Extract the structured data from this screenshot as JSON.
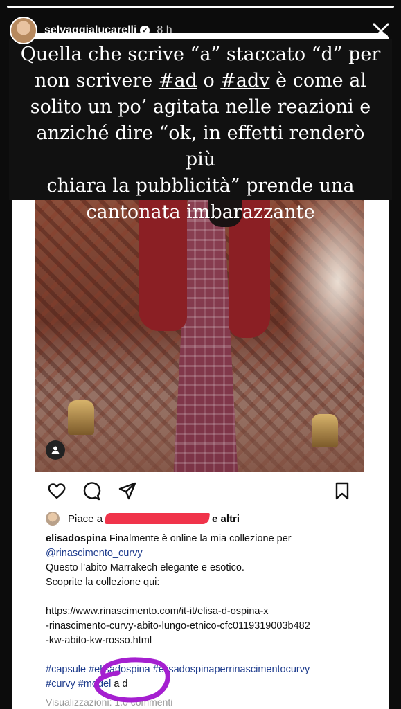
{
  "story": {
    "username": "selvaggialucarelli",
    "time": "8 h",
    "progress": 1.0,
    "caption_lines": [
      [
        "Quella che scrive “a” staccato “d” per"
      ],
      [
        "non scrivere ",
        "#ad",
        " o ",
        "#adv",
        " è come al"
      ],
      [
        "solito un po’ agitata nelle reazioni e"
      ],
      [
        "anziché dire “ok, in effetti renderò più"
      ],
      [
        "chiara la pubblicità” prende una"
      ],
      [
        "cantonata imbarazzante"
      ]
    ]
  },
  "post": {
    "likes_prefix": "Piace a",
    "likes_suffix": "e altri",
    "author": "elisadospina",
    "text_line1": "Finalmente è online la mia collezione per",
    "mention": "@rinascimento_curvy",
    "line3": "Questo l’abito Marrakech elegante e esotico.",
    "line4": "Scoprite la collezione qui:",
    "url_lines": [
      "https://www.rinascimento.com/it-it/elisa-d-ospina-x",
      "-rinascimento-curvy-abito-lungo-etnico-cfc0119319003b482",
      "-kw-abito-kw-rosso.html"
    ],
    "hashtags_line1": "#capsule #elisadospina #elisadospinaperrinascimentocurvy",
    "hashtags_line2": "#curvy #model",
    "ad_text": "a d",
    "views": "Visualizzazioni: 1.0 commenti"
  },
  "colors": {
    "caption_bg": "#111111",
    "link": "#1d3b8c",
    "redaction": "#f0334a",
    "marker": "#a51fd0"
  },
  "icons": [
    "heart-icon",
    "comment-icon",
    "share-icon",
    "bookmark-icon",
    "close-icon",
    "more-icon",
    "verified-icon",
    "user-tag-icon"
  ]
}
